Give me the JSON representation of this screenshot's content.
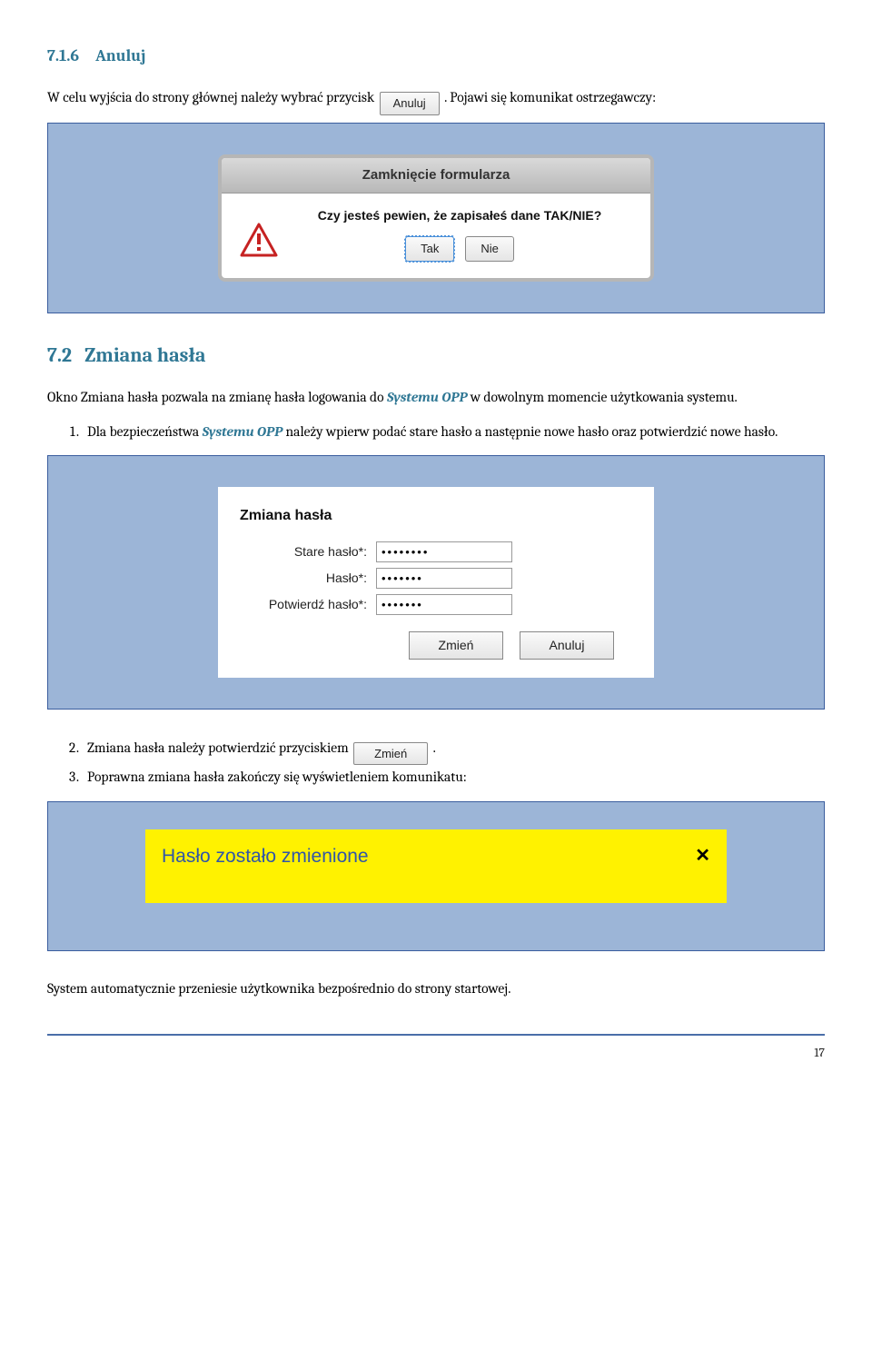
{
  "section_716": {
    "number": "7.1.6",
    "title": "Anuluj",
    "para_before": "W celu wyjścia do strony głównej należy wybrać przycisk ",
    "button_label": "Anuluj",
    "para_after": ". Pojawi się komunikat ostrzegawczy:"
  },
  "dialog": {
    "title": "Zamknięcie formularza",
    "message": "Czy jesteś pewien, że zapisałeś dane TAK/NIE?",
    "yes": "Tak",
    "no": "Nie"
  },
  "section_72": {
    "number": "7.2",
    "title": "Zmiana hasła",
    "intro_before": "Okno Zmiana hasła pozwala na zmianę hasła logowania do ",
    "system_name": "Systemu OPP",
    "intro_after": " w dowolnym momencie użytkowania systemu.",
    "item1_before": "Dla bezpieczeństwa ",
    "item1_after": " należy wpierw podać stare hasło a następnie nowe hasło oraz potwierdzić nowe hasło.",
    "item2_before": "Zmiana hasła należy potwierdzić przyciskiem ",
    "item2_button": "Zmień",
    "item2_after": ".",
    "item3": "Poprawna zmiana hasła zakończy się wyświetleniem komunikatu:"
  },
  "password_form": {
    "title": "Zmiana hasła",
    "old_label": "Stare hasło*:",
    "new_label": "Hasło*:",
    "confirm_label": "Potwierdź hasło*:",
    "old_value": "••••••••",
    "new_value": "•••••••",
    "confirm_value": "•••••••",
    "submit": "Zmień",
    "cancel": "Anuluj"
  },
  "success_banner": {
    "message": "Hasło zostało zmienione",
    "close": "✕"
  },
  "closing": "System automatycznie przeniesie użytkownika bezpośrednio do strony startowej.",
  "page_number": "17"
}
